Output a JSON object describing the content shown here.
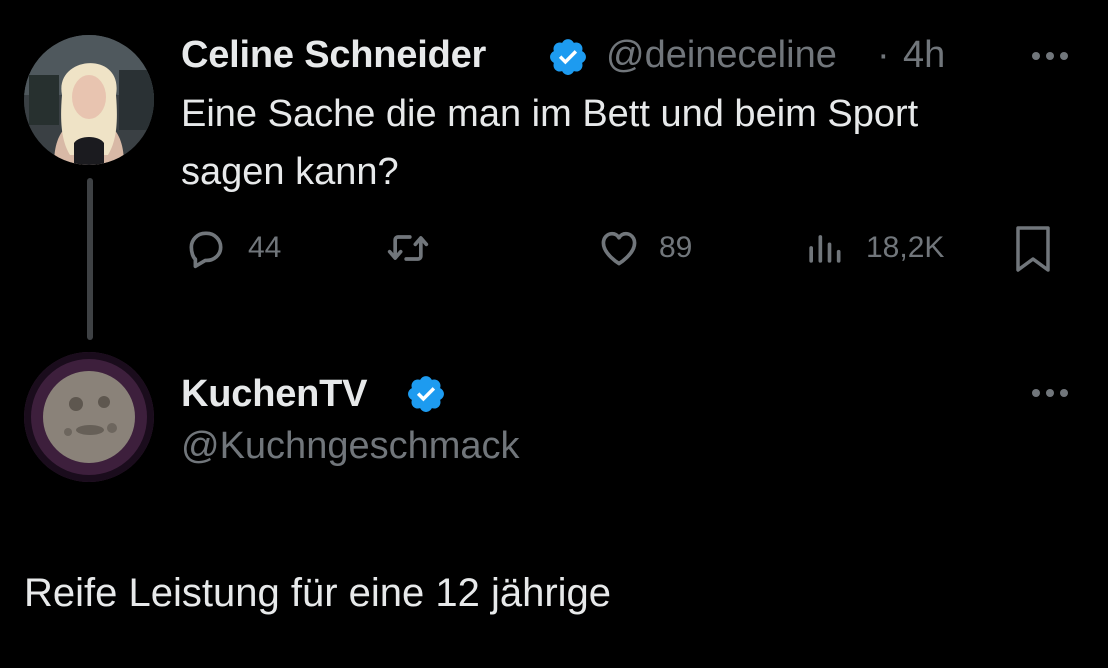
{
  "theme": {
    "background": "#000000",
    "text_primary": "#e7e9ea",
    "text_secondary": "#71767b",
    "verified_blue": "#1d9bf0",
    "thread_line": "#3e4144"
  },
  "original_tweet": {
    "author": {
      "display_name": "Celine Schneider",
      "verified": true,
      "handle": "@deineceline",
      "avatar_icon": "user-avatar-photo"
    },
    "separator": "·",
    "timestamp": "4h",
    "text_lines": [
      "Eine Sache die man im Bett und beim Sport",
      "sagen kann?"
    ],
    "actions": {
      "reply": {
        "icon": "speech-bubble-icon",
        "count": "44"
      },
      "retweet": {
        "icon": "retweet-icon",
        "count": ""
      },
      "like": {
        "icon": "heart-icon",
        "count": "89"
      },
      "views": {
        "icon": "bar-chart-icon",
        "count": "18,2K"
      },
      "bookmark": {
        "icon": "bookmark-icon"
      }
    },
    "more_icon": "ellipsis-icon"
  },
  "reply_tweet": {
    "author": {
      "display_name": "KuchenTV",
      "verified": true,
      "handle": "@Kuchngeschmack",
      "avatar_icon": "user-avatar-photo"
    },
    "text": "Reife Leistung für eine 12 jährige",
    "more_icon": "ellipsis-icon"
  }
}
